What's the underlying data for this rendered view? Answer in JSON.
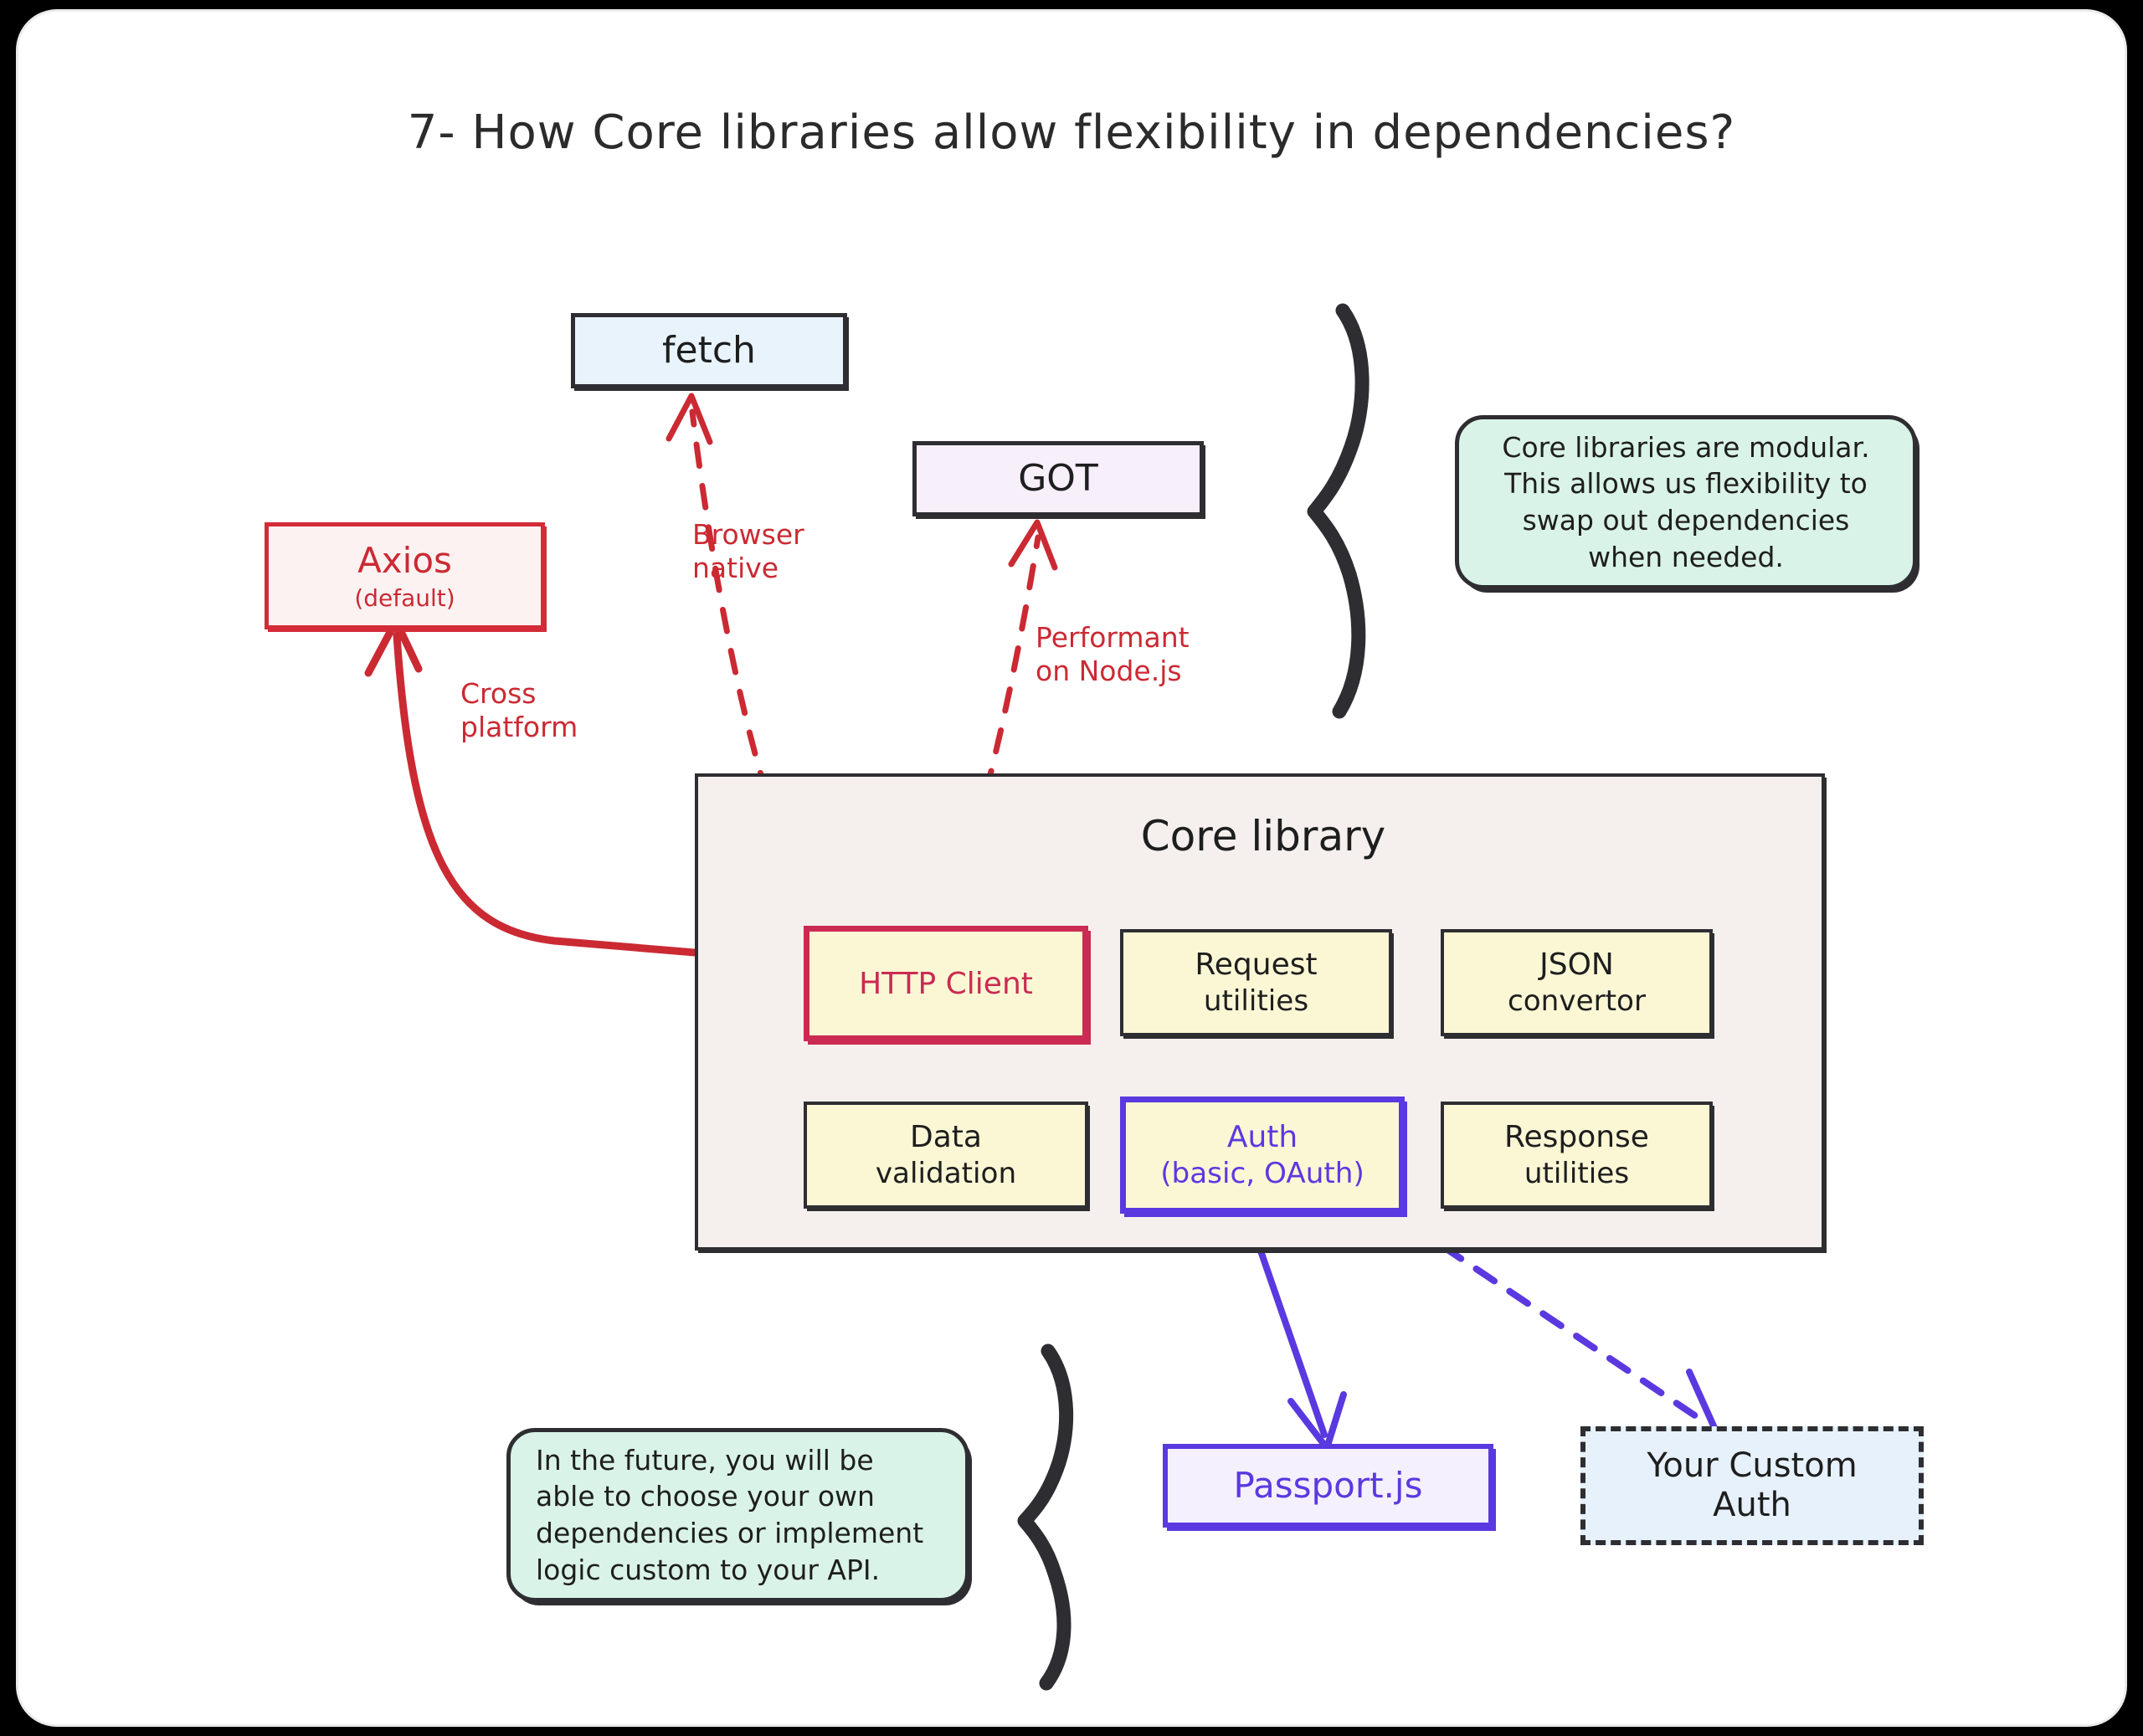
{
  "page": {
    "title": "7- How Core libraries allow flexibility in dependencies?"
  },
  "colors": {
    "red": "#cb2a33",
    "crimson": "#cb2a52",
    "purple": "#5b39e0",
    "ink": "#2e2e32",
    "note_green": "#daf3e8",
    "fetch_blue": "#e8f3fc",
    "got_lavender": "#f7effa",
    "axios_pink": "#fdf2f2",
    "core_bg": "#f5f0ee",
    "cell_yellow": "#fbf7d5",
    "custom_auth_blue": "#e6f1fb",
    "passport_lavender": "#f4f0fd"
  },
  "nodes": {
    "fetch": {
      "label": "fetch"
    },
    "got": {
      "label": "GOT"
    },
    "axios": {
      "label": "Axios",
      "sublabel": "(default)"
    },
    "passport": {
      "label": "Passport.js"
    },
    "custom_auth": {
      "line1": "Your Custom",
      "line2": "Auth"
    }
  },
  "core_library": {
    "title": "Core library",
    "cells": [
      {
        "id": "http-client",
        "line1": "HTTP Client",
        "line2": "",
        "highlight": "red"
      },
      {
        "id": "request-utilities",
        "line1": "Request",
        "line2": "utilities",
        "highlight": "none"
      },
      {
        "id": "json-convertor",
        "line1": "JSON",
        "line2": "convertor",
        "highlight": "none"
      },
      {
        "id": "data-validation",
        "line1": "Data",
        "line2": "validation",
        "highlight": "none"
      },
      {
        "id": "auth",
        "line1": "Auth",
        "line2": "(basic, OAuth)",
        "highlight": "purple"
      },
      {
        "id": "response-utilities",
        "line1": "Response",
        "line2": "utilities",
        "highlight": "none"
      }
    ]
  },
  "notes": {
    "top": "Core libraries are modular. This allows us flexibility to swap out dependencies when needed.",
    "bottom": "In the future, you will be able to choose your own dependencies or implement logic custom to your API."
  },
  "edge_labels": {
    "browser_native": "Browser\nnative",
    "performant_node": "Performant\non Node.js",
    "cross_platform": "Cross\nplatform"
  },
  "icons": {
    "brace_top": "curly-brace-icon",
    "brace_bottom": "curly-brace-icon"
  }
}
